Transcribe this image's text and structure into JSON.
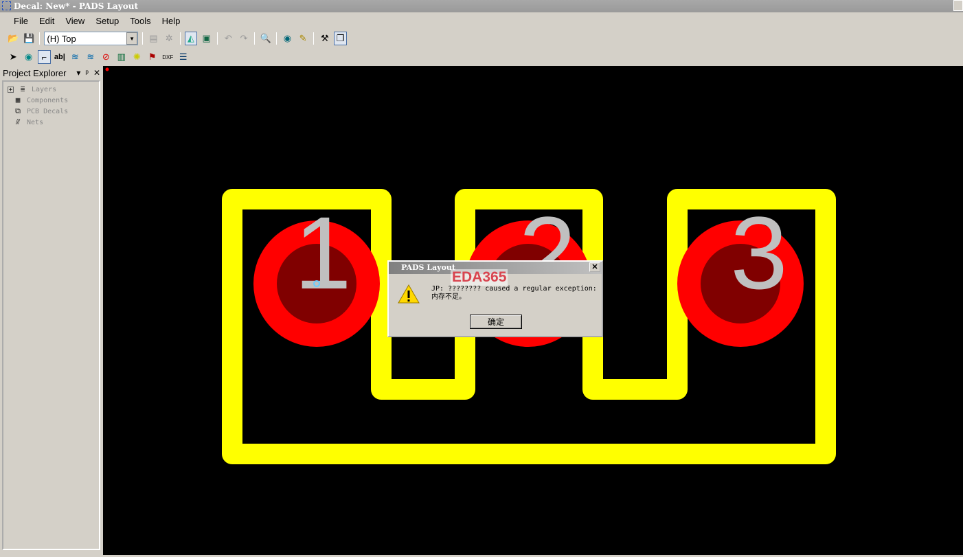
{
  "window": {
    "title": "Decal: New* - PADS Layout"
  },
  "menu": [
    "File",
    "Edit",
    "View",
    "Setup",
    "Tools",
    "Help"
  ],
  "toolbar": {
    "layer_select": "(H) Top"
  },
  "explorer": {
    "title": "Project Explorer",
    "items": [
      "Layers",
      "Components",
      "PCB Decals",
      "Nets"
    ]
  },
  "canvas": {
    "pins": [
      "1",
      "2",
      "3"
    ],
    "colors": {
      "outline": "#ffff00",
      "pad": "#ff0000",
      "drill": "#800000",
      "label": "#c0c0c0"
    }
  },
  "dialog": {
    "title": "PADS Layout",
    "line1": "JP: ???????? caused a regular exception:",
    "line2": "内存不足。",
    "ok": "确定"
  },
  "watermark": "EDA365"
}
